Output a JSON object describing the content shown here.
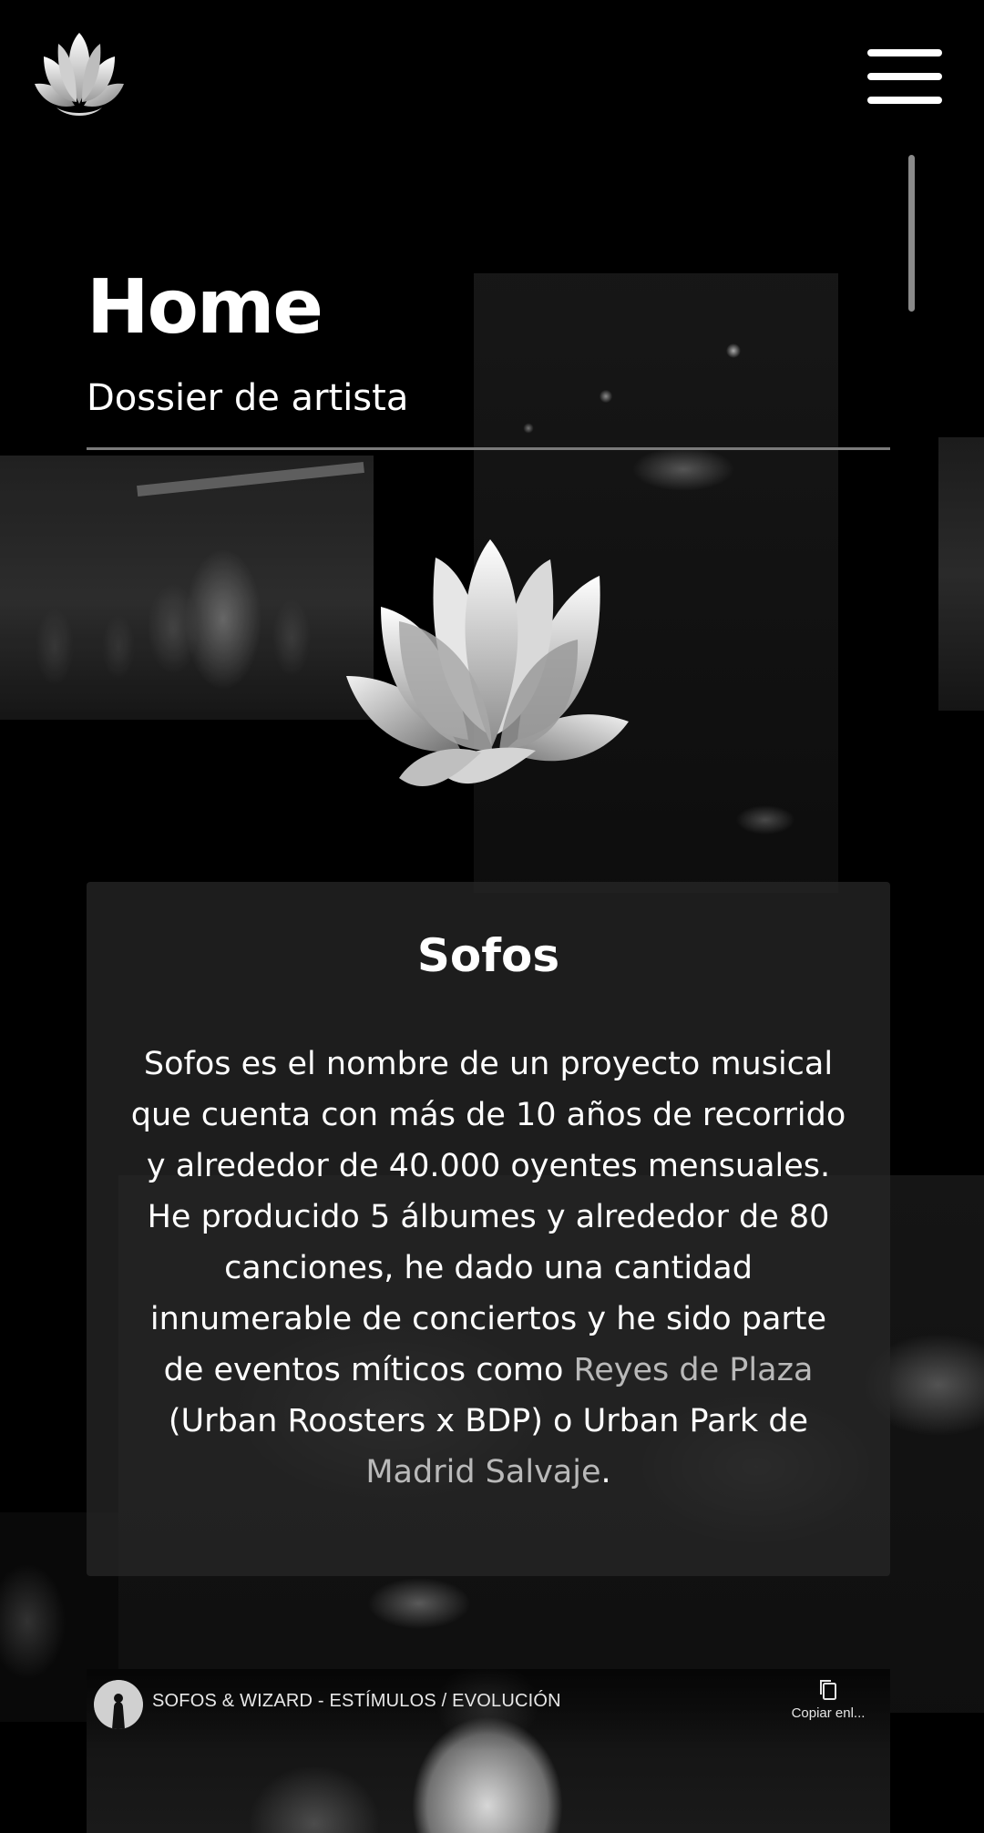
{
  "header": {
    "logo_icon": "lotus-flower-icon",
    "menu_icon": "hamburger-menu-icon"
  },
  "hero": {
    "title": "Home",
    "subtitle": "Dossier de artista",
    "emblem_icon": "lotus-flower-icon"
  },
  "card": {
    "title": "Sofos",
    "body_before_link1": "Sofos es el nombre de un proyecto musical que cuenta con más de 10 años de recorrido y alrededor de 40.000 oyentes mensuales. He producido 5 álbumes y alrededor de 80 canciones, he dado una cantidad innumerable de conciertos y he sido parte de eventos míticos como ",
    "link1": "Reyes de Plaza",
    "body_between": " (Urban Roosters x BDP) o Urban Park de ",
    "link2": "Madrid Salvaje",
    "body_after": "."
  },
  "video": {
    "title": "SOFOS & WIZARD - ESTÍMULOS / EVOLUCIÓN",
    "copy_label": "Copiar enl...",
    "copy_icon": "copy-icon"
  },
  "colors": {
    "background": "#000000",
    "card": "#282828",
    "link": "#b9b9b9",
    "text": "#ffffff"
  }
}
